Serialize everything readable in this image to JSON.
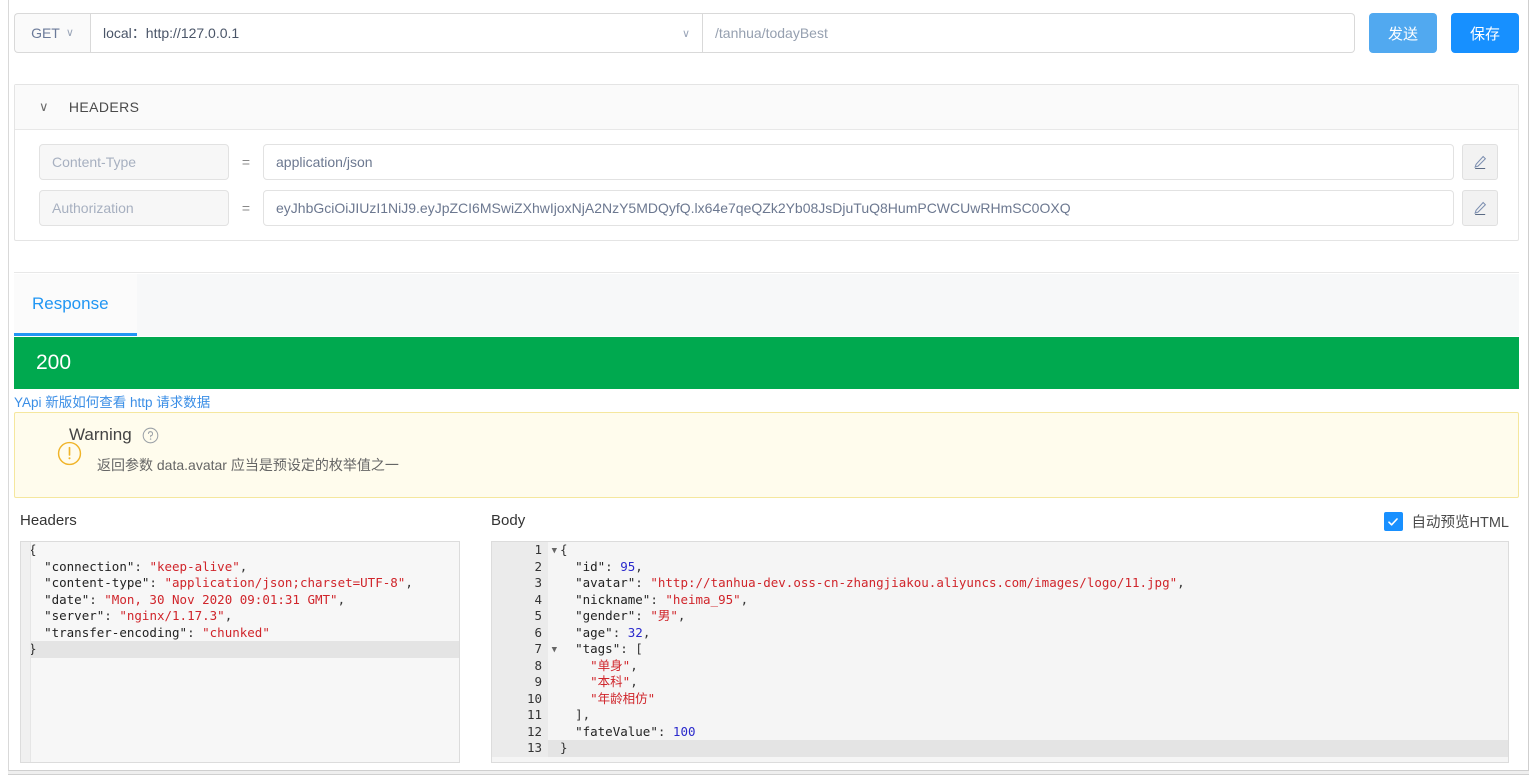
{
  "request_bar": {
    "method": "GET",
    "method_caret": "∨",
    "host": "local：http://127.0.0.1",
    "host_caret": "∨",
    "path_value": "/tanhua/todayBest",
    "send_label": "发送",
    "save_label": "保存",
    "send_color": "#51a9f0",
    "save_color": "#1790ff"
  },
  "headers_section": {
    "title": "HEADERS",
    "collapse_caret": "∨",
    "equals": "=",
    "rows": [
      {
        "name": "Content-Type",
        "value": "application/json"
      },
      {
        "name": "Authorization",
        "value": "eyJhbGciOiJIUzI1NiJ9.eyJpZCI6MSwiZXhwIjoxNjA2NzY5MDQyfQ.lx64e7qeQZk2Yb08JsDjuTuQ8HumPCWCUwRHmSC0OXQ"
      }
    ]
  },
  "response": {
    "tab_label": "Response",
    "tab_color": "#2196f3",
    "status_code": "200",
    "status_color": "#00a94f",
    "yapi_link": "YApi 新版如何查看 http 请求数据",
    "warning": {
      "title": "Warning",
      "help_icon": "question-circle",
      "message": "返回参数 data.avatar 应当是预设定的枚举值之一",
      "bg_color": "#fffced",
      "border_color": "#f5e79e",
      "icon_color": "#f0b429"
    }
  },
  "panes": {
    "headers_label": "Headers",
    "body_label": "Body",
    "autopreview_label": "自动预览HTML",
    "autopreview_checked": true
  },
  "headers_editor": {
    "lines": [
      {
        "text": "{",
        "active": false
      },
      {
        "text": "  \"connection\": \"keep-alive\",",
        "active": false
      },
      {
        "text": "  \"content-type\": \"application/json;charset=UTF-8\",",
        "active": false
      },
      {
        "text": "  \"date\": \"Mon, 30 Nov 2020 09:01:31 GMT\",",
        "active": false
      },
      {
        "text": "  \"server\": \"nginx/1.17.3\",",
        "active": false
      },
      {
        "text": "  \"transfer-encoding\": \"chunked\"",
        "active": false
      },
      {
        "text": "}",
        "active": true
      }
    ],
    "parsed": {
      "connection": "keep-alive",
      "content-type": "application/json;charset=UTF-8",
      "date": "Mon, 30 Nov 2020 09:01:31 GMT",
      "server": "nginx/1.17.3",
      "transfer-encoding": "chunked"
    }
  },
  "body_editor": {
    "lines": [
      {
        "num": "1",
        "fold": true,
        "active": false,
        "text": "{"
      },
      {
        "num": "2",
        "fold": false,
        "active": false,
        "text": "  \"id\": 95,"
      },
      {
        "num": "3",
        "fold": false,
        "active": false,
        "text": "  \"avatar\": \"http://tanhua-dev.oss-cn-zhangjiakou.aliyuncs.com/images/logo/11.jpg\","
      },
      {
        "num": "4",
        "fold": false,
        "active": false,
        "text": "  \"nickname\": \"heima_95\","
      },
      {
        "num": "5",
        "fold": false,
        "active": false,
        "text": "  \"gender\": \"男\","
      },
      {
        "num": "6",
        "fold": false,
        "active": false,
        "text": "  \"age\": 32,"
      },
      {
        "num": "7",
        "fold": true,
        "active": false,
        "text": "  \"tags\": ["
      },
      {
        "num": "8",
        "fold": false,
        "active": false,
        "text": "    \"单身\","
      },
      {
        "num": "9",
        "fold": false,
        "active": false,
        "text": "    \"本科\","
      },
      {
        "num": "10",
        "fold": false,
        "active": false,
        "text": "    \"年龄相仿\""
      },
      {
        "num": "11",
        "fold": false,
        "active": false,
        "text": "  ],"
      },
      {
        "num": "12",
        "fold": false,
        "active": false,
        "text": "  \"fateValue\": 100"
      },
      {
        "num": "13",
        "fold": false,
        "active": true,
        "text": "}"
      }
    ],
    "parsed": {
      "id": 95,
      "avatar": "http://tanhua-dev.oss-cn-zhangjiakou.aliyuncs.com/images/logo/11.jpg",
      "nickname": "heima_95",
      "gender": "男",
      "age": 32,
      "tags": [
        "单身",
        "本科",
        "年龄相仿"
      ],
      "fateValue": 100
    }
  }
}
